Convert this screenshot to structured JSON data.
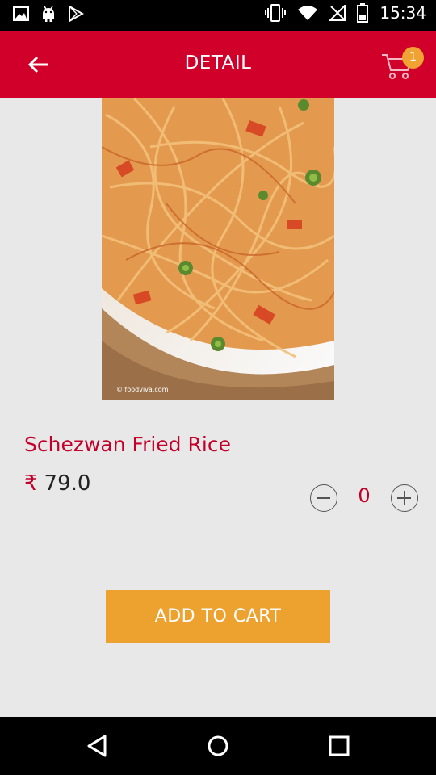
{
  "status_bar": {
    "time": "15:34",
    "icons": [
      "image-icon",
      "android-icon",
      "play-store-icon",
      "vibrate-icon",
      "wifi-icon",
      "no-signal-icon",
      "battery-icon"
    ]
  },
  "header": {
    "title": "DETAIL",
    "cart_count": "1"
  },
  "product": {
    "name": "Schezwan Fried Rice",
    "currency": "₹",
    "price": "79.0",
    "quantity": "0",
    "image_watermark": "© foodviva.com"
  },
  "actions": {
    "add_to_cart": "ADD TO CART"
  },
  "colors": {
    "primary": "#d0002b",
    "accent": "#eda12f",
    "background": "#e8e8e8"
  }
}
